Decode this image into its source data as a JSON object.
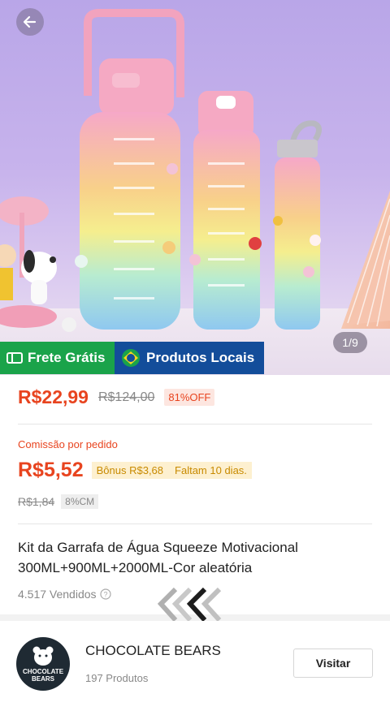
{
  "hero": {
    "image_description_icon": "water-bottles-product-photo",
    "counter": "1/9"
  },
  "badges": {
    "frete": "Frete Grátis",
    "locais": "Produtos Locais"
  },
  "price": {
    "current": "R$22,99",
    "original": "R$124,00",
    "discount": "81%OFF"
  },
  "commission": {
    "label": "Comissão por pedido",
    "value": "R$5,52",
    "bonus": "Bônus R$3,68",
    "remaining": "Faltam 10 dias.",
    "old_value": "R$1,84",
    "cm_badge": "8%CM"
  },
  "product": {
    "title": "Kit da Garrafa de Água Squeeze Motivacional 300ML+900ML+2000ML-Cor aleatória",
    "sold": "4.517 Vendidos"
  },
  "shop": {
    "name": "CHOCOLATE BEARS",
    "products": "197 Produtos",
    "logo_text_line1": "CHOCOLATE",
    "logo_text_line2": "BEARS",
    "visit_label": "Visitar"
  },
  "colors": {
    "accent": "#e8441f",
    "frete_green": "#1aa34a",
    "local_blue": "#134d9a"
  }
}
